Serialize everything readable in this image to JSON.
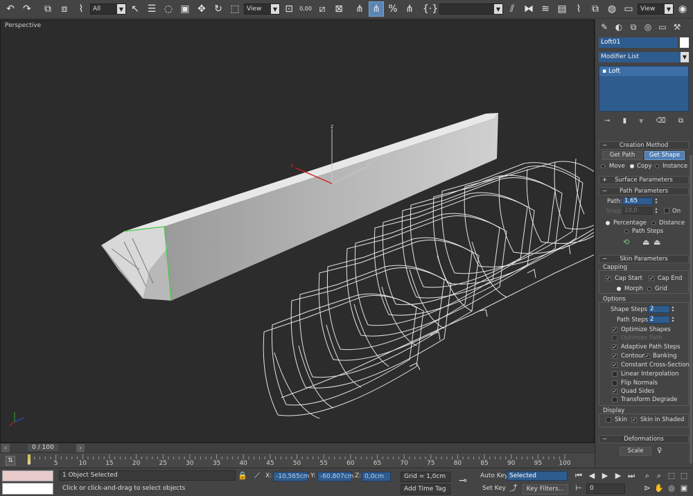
{
  "toolbar": {
    "selection_filter": "All",
    "ref_coord": "View",
    "named_selection": "",
    "view_dropdown": "View",
    "angle_snap_value": "0,00"
  },
  "viewport": {
    "label": "Perspective",
    "gizmo_labels": {
      "x": "x",
      "y": "y",
      "z": "z"
    }
  },
  "command_panel": {
    "object_name": "Loft01",
    "object_color": "#ffffff",
    "modifier_list": "Modifier List",
    "stack_item": "Loft",
    "creation_method": {
      "title": "Creation Method",
      "get_path": "Get Path",
      "get_shape": "Get Shape",
      "move": "Move",
      "copy": "Copy",
      "instance": "Instance"
    },
    "surface_parameters": {
      "title": "Surface Parameters"
    },
    "path_parameters": {
      "title": "Path Parameters",
      "path_label": "Path:",
      "path_value": "1,65",
      "snap_label": "Snap:",
      "snap_value": "10,0",
      "on_label": "On",
      "percentage": "Percentage",
      "distance": "Distance",
      "path_steps": "Path Steps"
    },
    "skin_parameters": {
      "title": "Skin Parameters",
      "capping": "Capping",
      "cap_start": "Cap Start",
      "cap_end": "Cap End",
      "morph": "Morph",
      "grid": "Grid",
      "options": "Options",
      "shape_steps_label": "Shape Steps:",
      "shape_steps_value": "2",
      "path_steps_label": "Path Steps:",
      "path_steps_value": "2",
      "optimize_shapes": "Optimize Shapes",
      "optimize_path": "Optimize Path",
      "adaptive_path_steps": "Adaptive Path Steps",
      "contour": "Contour",
      "banking": "Banking",
      "constant_cross_section": "Constant Cross-Section",
      "linear_interpolation": "Linear Interpolation",
      "flip_normals": "Flip Normals",
      "quad_sides": "Quad Sides",
      "transform_degrade": "Transform Degrade",
      "display": "Display",
      "skin": "Skin",
      "skin_in_shaded": "Skin in Shaded"
    },
    "deformations": {
      "title": "Deformations",
      "scale": "Scale"
    }
  },
  "timeslider": {
    "label": "0 / 100",
    "ticks": [
      "0",
      "5",
      "10",
      "15",
      "20",
      "25",
      "30",
      "35",
      "40",
      "45",
      "50",
      "55",
      "60",
      "65",
      "70",
      "75",
      "80",
      "85",
      "90",
      "95",
      "100"
    ]
  },
  "status": {
    "selection": "1 Object Selected",
    "prompt": "Click or click-and-drag to select objects",
    "x_label": "X:",
    "x_value": "-10,565cm",
    "y_label": "Y:",
    "y_value": "-60,807cm",
    "z_label": "Z:",
    "z_value": "0,0cm",
    "grid": "Grid = 1,0cm",
    "add_time_tag": "Add Time Tag",
    "auto_key": "Auto Key",
    "set_key": "Set Key",
    "key_mode": "Selected",
    "key_filters": "Key Filters...",
    "frame": "0"
  }
}
